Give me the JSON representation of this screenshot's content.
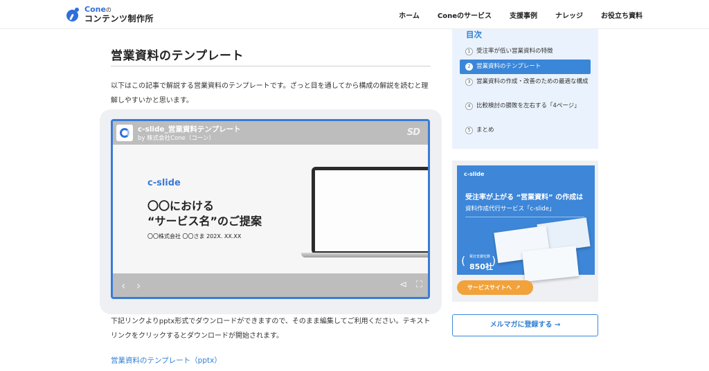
{
  "header": {
    "logo_line1": "Cone",
    "logo_no": "の",
    "logo_line2": "コンテンツ制作所",
    "nav": [
      "ホーム",
      "Coneのサービス",
      "支援事例",
      "ナレッジ",
      "お役立ち資料"
    ]
  },
  "article": {
    "heading": "営業資料のテンプレート",
    "intro": "以下はこの記事で解説する営業資料のテンプレートです。ざっと目を通してから構成の解説を読むと理解しやすいかと思います。",
    "after_embed": "下記リンクよりpptx形式でダウンロードができますので、そのまま編集してご利用ください。テキストリンクをクリックするとダウンロードが開始されます。",
    "download_link": "営業資料のテンプレート（pptx）"
  },
  "embed": {
    "title": "c-slide_営業資料テンプレート",
    "by": "by 株式会社Cone（コーン）",
    "sd_mark": "SD",
    "slide_brand": "c-slide",
    "slide_head1": "〇〇における",
    "slide_head2": "“サービス名”のご提案",
    "slide_meta": "〇〇株式会社 〇〇さま 202X. XX.XX"
  },
  "toc": {
    "title": "目次",
    "items": [
      {
        "num": "1",
        "label": "受注率が低い営業資料の特徴"
      },
      {
        "num": "2",
        "label": "営業資料のテンプレート"
      },
      {
        "num": "3",
        "label": "営業資料の作成・改善のための最適な構成"
      },
      {
        "num": "4",
        "label": "比較検討の勝敗を左右する「4ページ」"
      },
      {
        "num": "5",
        "label": "まとめ"
      }
    ],
    "active_index": 1
  },
  "promo": {
    "logo": "c-slide",
    "line1": "受注率が上がる “営業資料” の作成は",
    "line2": "資料作成代行サービス「c-slide」",
    "badge_caption": "累計支援社数",
    "badge_number": "850社",
    "button": "サービスサイトへ"
  },
  "newsletter_button": "メルマガに登録する →"
}
